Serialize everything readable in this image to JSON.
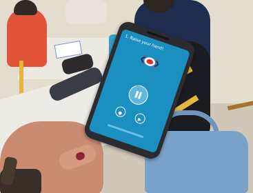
{
  "photo": {
    "description_hidden": "",
    "phone_app": {
      "prompt": "1. Raise your hand!",
      "icons": [
        "back-arrow-icon",
        "microphone-wave-icon",
        "pause-icon",
        "record-icon",
        "replay-icon"
      ]
    }
  },
  "colors": {
    "phone_screen": "#1c8fc1",
    "phone_body": "#2c2c30",
    "nail_polish": "#8b2332",
    "chair": "#e5b83d",
    "backpack": "#7aa2c9"
  }
}
